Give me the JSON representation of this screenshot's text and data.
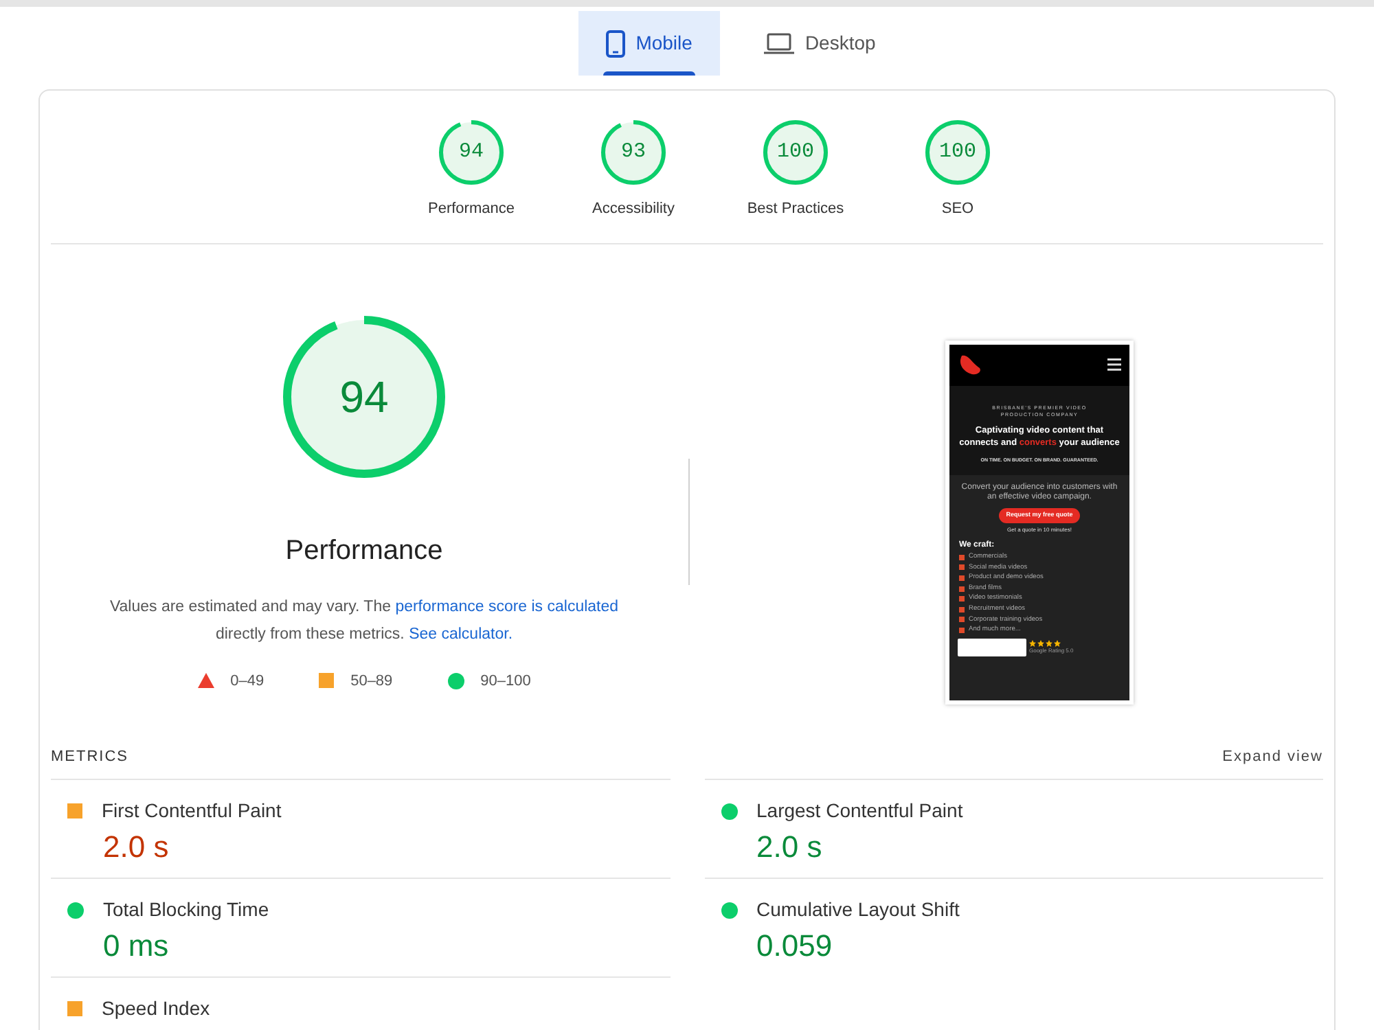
{
  "tabs": [
    {
      "label": "Mobile",
      "kind": "phone",
      "selected": true
    },
    {
      "label": "Desktop",
      "kind": "laptop",
      "selected": false
    }
  ],
  "categories": [
    {
      "score": "94",
      "label": "Performance",
      "level": 0.94
    },
    {
      "score": "93",
      "label": "Accessibility",
      "level": 0.93
    },
    {
      "score": "100",
      "label": "Best Practices",
      "level": 1
    },
    {
      "score": "100",
      "label": "SEO",
      "level": 1
    }
  ],
  "summary": {
    "score": "94",
    "level": 0.94,
    "title": "Performance",
    "description_before": "Values are estimated and may vary. The ",
    "link_1": "performance score is calculated",
    "description_middle": " directly from these metrics. ",
    "link_2": "See calculator."
  },
  "legend": [
    {
      "kind": "fail",
      "label": "0–49"
    },
    {
      "kind": "average",
      "label": "50–89"
    },
    {
      "kind": "pass",
      "label": "90–100"
    }
  ],
  "screenshot": {
    "tagline": "BRISBANE'S PREMIER VIDEO PRODUCTION COMPANY",
    "headline_before": "Captivating video content that connects and ",
    "headline_accent": "converts",
    "headline_after": " your audience",
    "guarantee": "ON TIME. ON BUDGET. ON BRAND. GUARANTEED.",
    "pitch": "Convert your audience into customers with an effective video campaign.",
    "cta": "Request my free quote",
    "cta_note": "Get a quote in 10 minutes!",
    "list_title": "We craft:",
    "list": [
      "Commercials",
      "Social media videos",
      "Product and demo videos",
      "Brand films",
      "Video testimonials",
      "Recruitment videos",
      "Corporate training videos",
      "And much more..."
    ],
    "rating": "Google Rating 5.0"
  },
  "metrics_title": "METRICS",
  "expand": "Expand view",
  "metrics": [
    {
      "label": "First Contentful Paint",
      "value": "2.0 s",
      "kind": "average"
    },
    {
      "label": "Largest Contentful Paint",
      "value": "2.0 s",
      "kind": "pass"
    },
    {
      "label": "Total Blocking Time",
      "value": "0 ms",
      "kind": "pass"
    },
    {
      "label": "Cumulative Layout Shift",
      "value": "0.059",
      "kind": "pass"
    },
    {
      "label": "Speed Index",
      "kind": "average"
    }
  ]
}
